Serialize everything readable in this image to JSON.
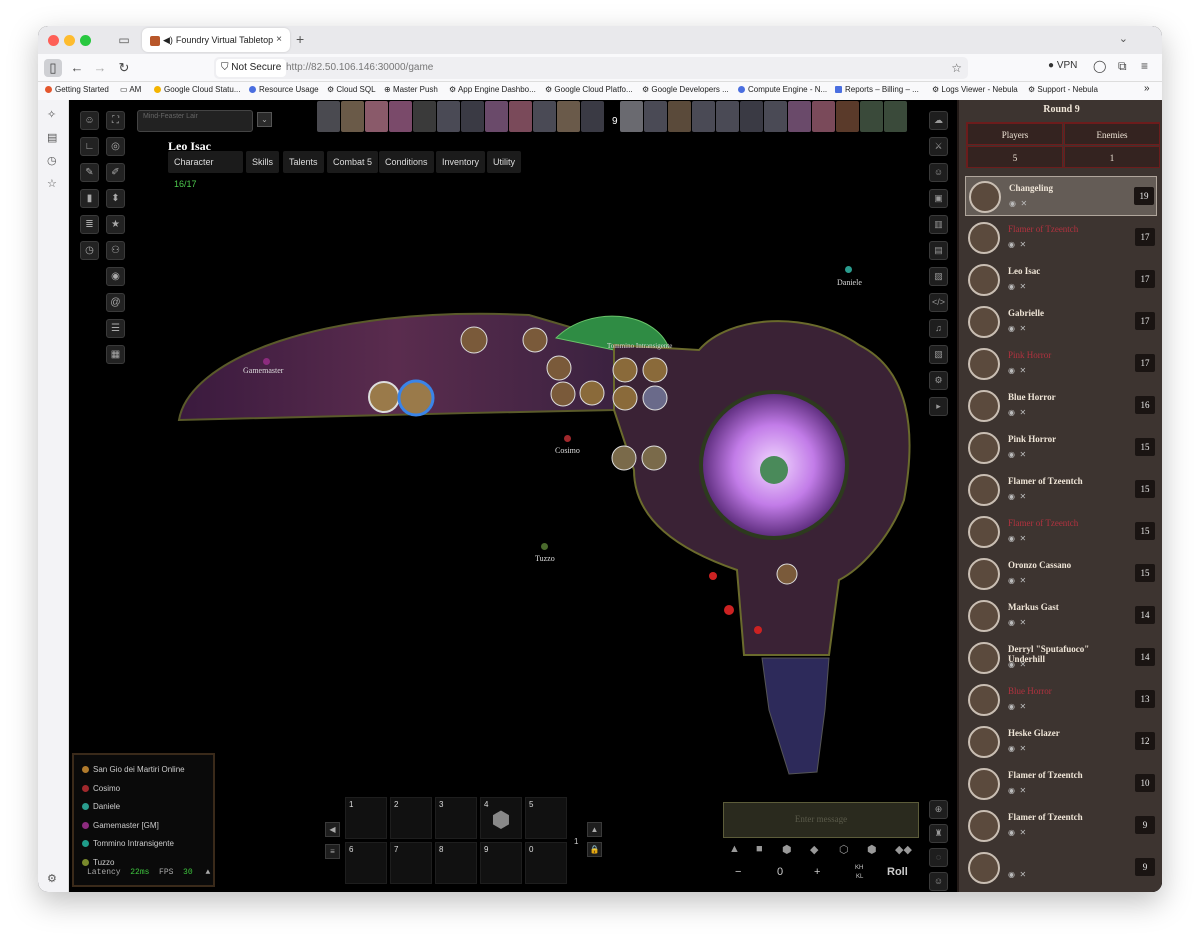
{
  "browser": {
    "tab_title": "Foundry Virtual Tabletop",
    "tab_close": "×",
    "new_tab": "+",
    "security": "Not Secure",
    "url_host": "http://82.50.106.146",
    "url_path": ":30000/game",
    "vpn": "VPN",
    "bookmarks": [
      "Getting Started",
      "AM",
      "Google Cloud Statu...",
      "Resource Usage",
      "Cloud SQL",
      "Master Push",
      "App Engine Dashbo...",
      "Google Cloud Platfo...",
      "Google Developers ...",
      "Compute Engine - N...",
      "Reports – Billing – ...",
      "Logs Viewer - Nebula",
      "Support - Nebula"
    ]
  },
  "scene": {
    "selector_label": "Mind-Feaster Lair",
    "turn_number": "9",
    "character_name": "Leo Isac",
    "tabs": [
      {
        "label": "Character",
        "badge": "16/17"
      },
      {
        "label": "Skills",
        "badge": ""
      },
      {
        "label": "Talents",
        "badge": ""
      },
      {
        "label": "Combat",
        "badge": "5"
      },
      {
        "label": "Conditions",
        "badge": ""
      },
      {
        "label": "Inventory",
        "badge": ""
      },
      {
        "label": "Utility",
        "badge": ""
      }
    ],
    "map_labels": {
      "gamemaster": "Gamemaster",
      "tommino": "Tommino Intransigente",
      "cosimo": "Cosimo",
      "tuzzo": "Tuzzo",
      "daniele": "Daniele"
    }
  },
  "tracker": {
    "round": "Round 9",
    "players_label": "Players",
    "enemies_label": "Enemies",
    "players_count": "5",
    "enemies_count": "1",
    "combatants": [
      {
        "name": "Changeling",
        "init": "19",
        "hidden": false,
        "active": true
      },
      {
        "name": "Flamer of Tzeentch",
        "init": "17",
        "hidden": true,
        "active": false
      },
      {
        "name": "Leo Isac",
        "init": "17",
        "hidden": false,
        "active": false
      },
      {
        "name": "Gabrielle",
        "init": "17",
        "hidden": false,
        "active": false
      },
      {
        "name": "Pink Horror",
        "init": "17",
        "hidden": true,
        "active": false
      },
      {
        "name": "Blue Horror",
        "init": "16",
        "hidden": false,
        "active": false
      },
      {
        "name": "Pink Horror",
        "init": "15",
        "hidden": false,
        "active": false
      },
      {
        "name": "Flamer of Tzeentch",
        "init": "15",
        "hidden": false,
        "active": false
      },
      {
        "name": "Flamer of Tzeentch",
        "init": "15",
        "hidden": true,
        "active": false
      },
      {
        "name": "Oronzo Cassano",
        "init": "15",
        "hidden": false,
        "active": false
      },
      {
        "name": "Markus Gast",
        "init": "14",
        "hidden": false,
        "active": false
      },
      {
        "name": "Derryl \"Sputafuoco\" Underhill",
        "init": "14",
        "hidden": false,
        "active": false
      },
      {
        "name": "Blue Horror",
        "init": "13",
        "hidden": true,
        "active": false
      },
      {
        "name": "Heske Glazer",
        "init": "12",
        "hidden": false,
        "active": false
      },
      {
        "name": "Flamer of Tzeentch",
        "init": "10",
        "hidden": false,
        "active": false
      },
      {
        "name": "Flamer of Tzeentch",
        "init": "9",
        "hidden": false,
        "active": false
      },
      {
        "name": "",
        "init": "9",
        "hidden": false,
        "active": false
      }
    ]
  },
  "players": [
    {
      "name": "San Gio dei Martiri Online",
      "color": "#b07a2c"
    },
    {
      "name": "Cosimo",
      "color": "#a0282c"
    },
    {
      "name": "Daniele",
      "color": "#2a9c8e"
    },
    {
      "name": "Gamemaster [GM]",
      "color": "#8c2b7e"
    },
    {
      "name": "Tommino Intransigente",
      "color": "#1f9c8a"
    },
    {
      "name": "Tuzzo",
      "color": "#7a8a2c"
    }
  ],
  "latency": {
    "label": "Latency",
    "value": "22ms",
    "fps_label": "FPS",
    "fps": "30"
  },
  "hotbar": {
    "slots": [
      "1",
      "2",
      "3",
      "4",
      "5",
      "6",
      "7",
      "8",
      "9",
      "0"
    ],
    "page": "1"
  },
  "chat": {
    "placeholder": "Enter message"
  },
  "roll": {
    "modifier": "0",
    "minus": "−",
    "plus": "+",
    "kh": "KH",
    "kl": "KL",
    "roll_label": "Roll"
  }
}
